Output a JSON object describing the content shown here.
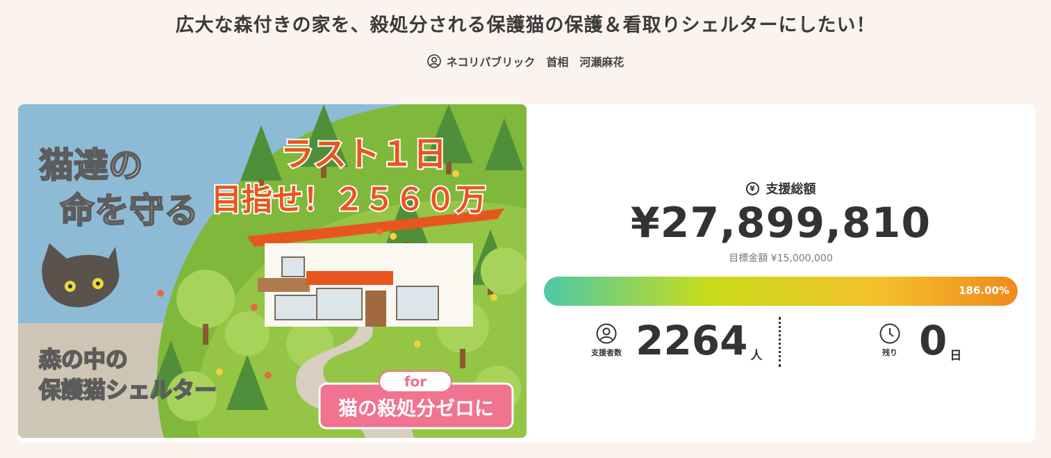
{
  "project": {
    "title": "広大な森付きの家を、殺処分される保護猫の保護＆看取りシェルターにしたい！",
    "owner": "ネコリパブリック　首相　河瀬麻花"
  },
  "hero": {
    "headline_line1": "猫達の",
    "headline_line2": "命を守る",
    "last_days": "ラスト１日",
    "target": "目指せ！２５６０万",
    "subtitle_line1": "森の中の",
    "subtitle_line2": "保護猫シェルター",
    "for_label": "for",
    "badge": "猫の殺処分ゼロに"
  },
  "funding": {
    "yen_icon": "¥",
    "total_label": "支援総額",
    "total_amount": "¥27,899,810",
    "goal_text": "目標金額 ¥15,000,000",
    "progress_text": "186.00%",
    "progress_fraction": 1.0
  },
  "backers": {
    "icon": "user-circle-icon",
    "caption": "支援者数",
    "count": "2264",
    "unit": "人"
  },
  "remaining": {
    "icon": "clock-icon",
    "caption": "残り",
    "count": "0",
    "unit": "日"
  },
  "colors": {
    "background": "#fbf3ee",
    "accent_orange": "#e8561f",
    "badge_pink": "#f0738f",
    "progress_start": "#4cc9a8",
    "progress_end": "#f08a1c"
  }
}
